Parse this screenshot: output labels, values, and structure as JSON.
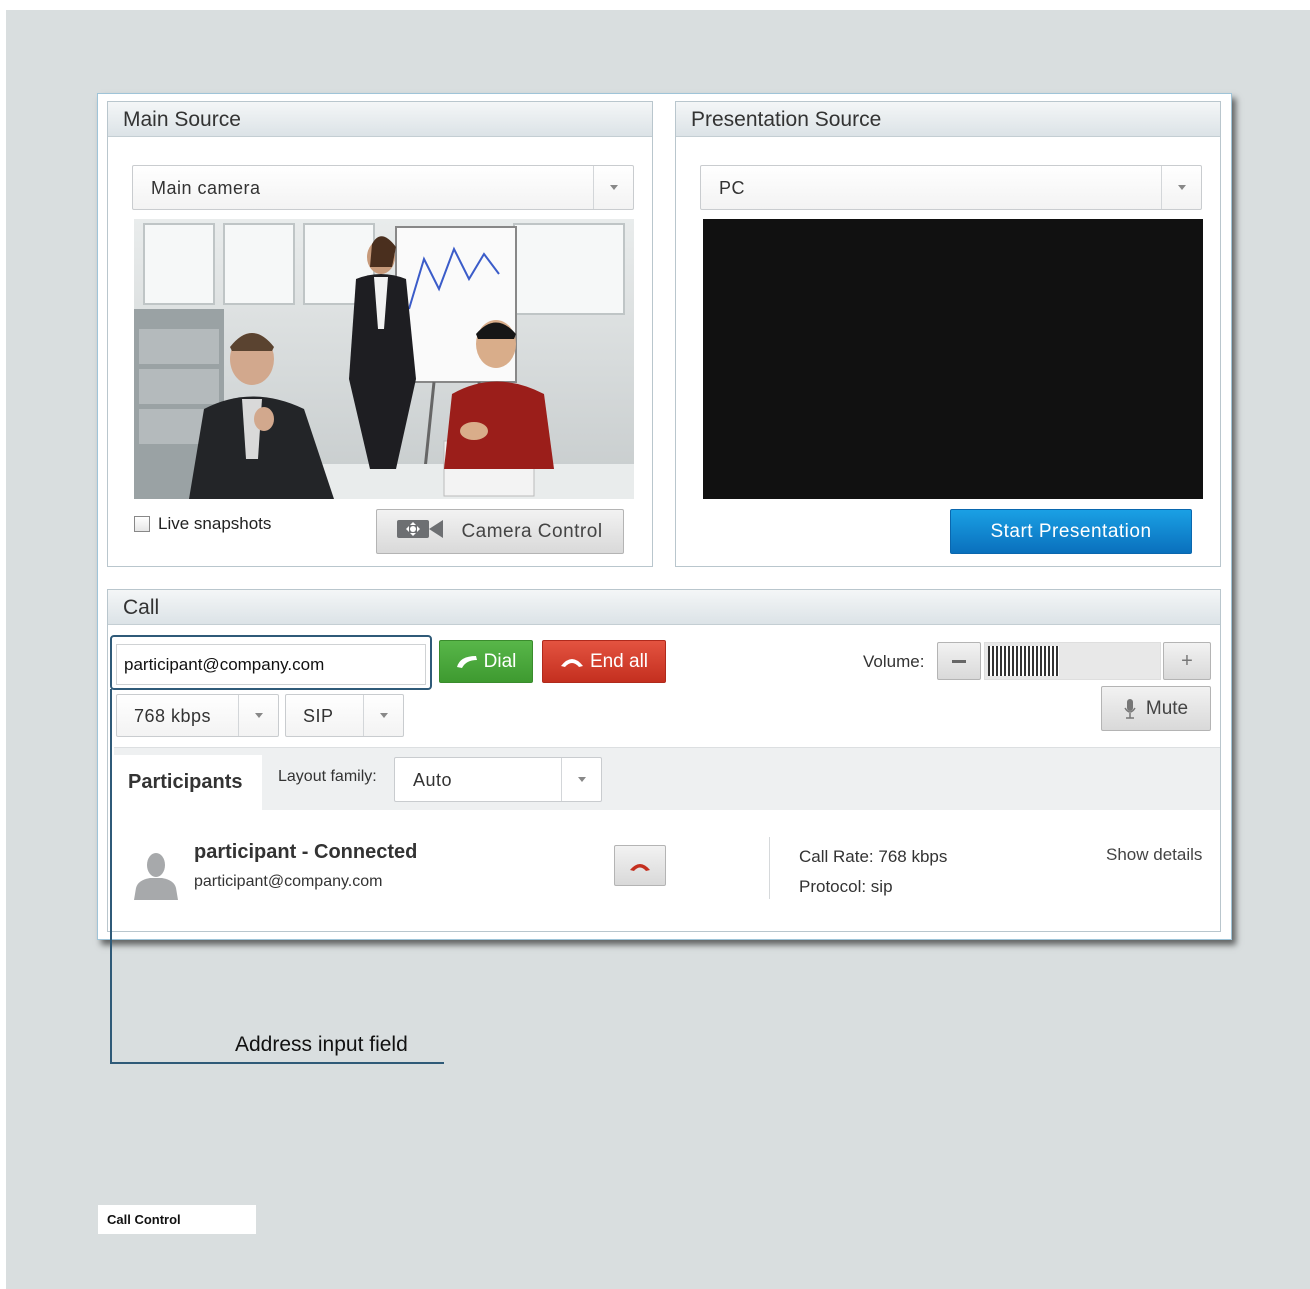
{
  "main_source": {
    "title": "Main Source",
    "camera_select": "Main camera",
    "live_snapshots_label": "Live snapshots",
    "camera_control_label": "Camera Control"
  },
  "presentation_source": {
    "title": "Presentation Source",
    "source_select": "PC",
    "start_button_label": "Start Presentation"
  },
  "call": {
    "title": "Call",
    "address_value": "participant@company.com",
    "dial_label": "Dial",
    "end_all_label": "End all",
    "volume_label": "Volume:",
    "volume_level": 0.42,
    "mute_label": "Mute",
    "rate_select": "768 kbps",
    "protocol_select": "SIP"
  },
  "participants": {
    "tab_label": "Participants",
    "layout_family_label": "Layout family:",
    "layout_select": "Auto",
    "items": [
      {
        "name": "participant - Connected",
        "address": "participant@company.com",
        "call_rate": "Call Rate: 768 kbps",
        "protocol": "Protocol: sip",
        "details_link": "Show details"
      }
    ]
  },
  "annotation": {
    "callout_label": "Address input field"
  },
  "footer": {
    "section_label": "Call Control"
  },
  "colors": {
    "accent_blue": "#0a84d4",
    "dial_green": "#4caa3c",
    "end_red": "#d23e2c",
    "callout": "#2f5a78"
  }
}
